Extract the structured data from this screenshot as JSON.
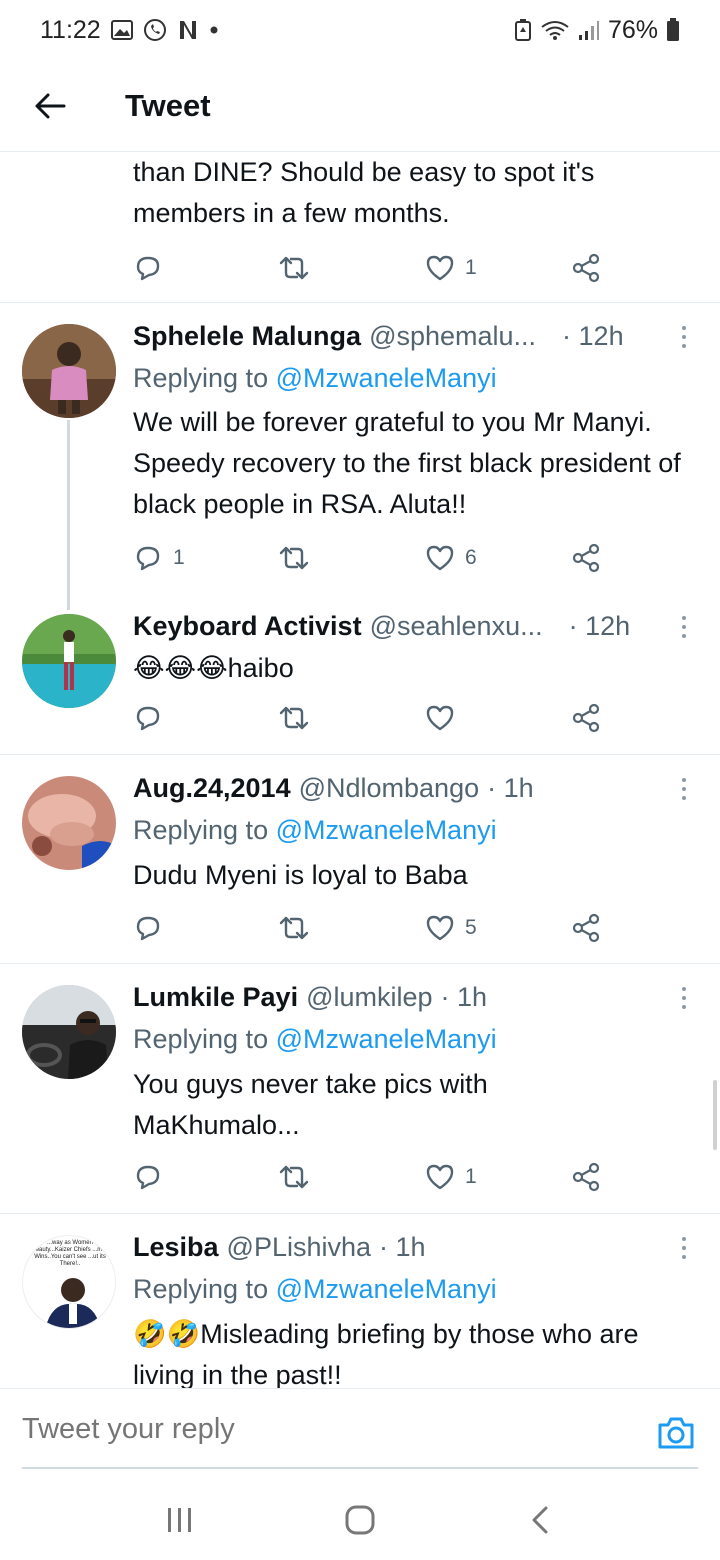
{
  "status_bar": {
    "time": "11:22",
    "battery": "76%",
    "left_icons": [
      "gallery-icon",
      "whatsapp-icon",
      "netflix-icon",
      "dot-icon"
    ],
    "right_icons": [
      "battery-saver-icon",
      "wifi-icon",
      "signal-icon",
      "battery-icon"
    ]
  },
  "header": {
    "title": "Tweet",
    "back_icon": "arrow-left-icon"
  },
  "partial_tweet": {
    "text_line1": "than DINE? Should be easy to spot it's",
    "text_line2": "members in a few months.",
    "like_count": "1"
  },
  "tweets": [
    {
      "name": "Sphelele Malunga",
      "handle": "@sphemalu...",
      "time": "· 12h",
      "replying_prefix": "Replying to",
      "replying_to": "@MzwaneleManyi",
      "body": "We will be forever grateful to you Mr Manyi. Speedy recovery to the first black president of black people in RSA. Aluta!!",
      "reply_count": "1",
      "like_count": "6"
    },
    {
      "name": "Keyboard Activist",
      "handle": "@seahlenxu...",
      "time": "· 12h",
      "body": "😂😂😂haibo",
      "reply_count": "",
      "like_count": ""
    },
    {
      "name": "Aug.24,2014",
      "handle": "@Ndlombango",
      "time": "· 1h",
      "replying_prefix": "Replying to",
      "replying_to": "@MzwaneleManyi",
      "body": "Dudu Myeni is loyal to Baba",
      "reply_count": "",
      "like_count": "5"
    },
    {
      "name": "Lumkile Payi",
      "handle": "@lumkilep",
      "time": "· 1h",
      "replying_prefix": "Replying to",
      "replying_to": "@MzwaneleManyi",
      "body": "You guys never take pics with MaKhumalo...",
      "reply_count": "",
      "like_count": "1"
    },
    {
      "name": "Lesiba",
      "handle": "@PLishivha",
      "time": "· 1h",
      "replying_prefix": "Replying to",
      "replying_to": "@MzwaneleManyi",
      "body": "🤣🤣Misleading briefing by those who are living in the past!!",
      "avatar_caption": "...way as Women beauty...Kaizer Chiefs ...mer Wins..You can't see ...ut its There!.."
    }
  ],
  "reply_bar": {
    "placeholder": "Tweet your reply",
    "camera_icon": "camera-icon"
  },
  "nav_bar": {
    "icons": [
      "recent-apps-icon",
      "home-icon",
      "back-icon"
    ]
  },
  "colors": {
    "accent": "#1d9bf0",
    "secondary_text": "#536471",
    "divider": "#e6ecf0"
  }
}
